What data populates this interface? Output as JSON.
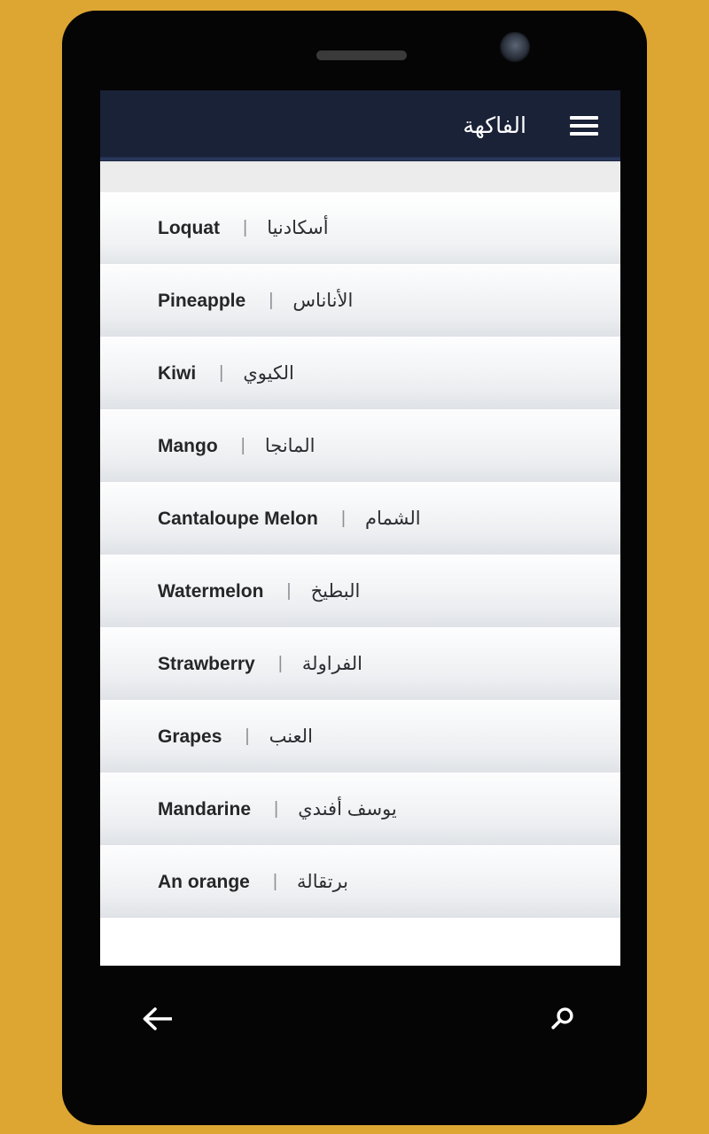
{
  "background": {
    "color": "#DDA633"
  },
  "device": {
    "name": "smartphone-mockup",
    "body_color": "#050505",
    "speaker": "speaker-grille",
    "camera": "front-camera"
  },
  "header": {
    "title": "الفاكهة",
    "background_color": "#1A2238",
    "text_color": "#FFFFFF",
    "menu_icon": "hamburger-menu-icon"
  },
  "list": {
    "items": [
      {
        "en": "Loquat",
        "sep": "|",
        "ar": "أسكادنيا"
      },
      {
        "en": "Pineapple",
        "sep": "|",
        "ar": "الأناناس"
      },
      {
        "en": "Kiwi",
        "sep": "|",
        "ar": "الكيوي"
      },
      {
        "en": "Mango",
        "sep": "|",
        "ar": "المانجا"
      },
      {
        "en": "Cantaloupe Melon",
        "sep": "|",
        "ar": "الشمام"
      },
      {
        "en": "Watermelon",
        "sep": "|",
        "ar": "البطيخ"
      },
      {
        "en": "Strawberry",
        "sep": "|",
        "ar": "الفراولة"
      },
      {
        "en": "Grapes",
        "sep": "|",
        "ar": "العنب"
      },
      {
        "en": "Mandarine",
        "sep": "|",
        "ar": "يوسف أفندي"
      },
      {
        "en": "An orange",
        "sep": "|",
        "ar": "برتقالة"
      }
    ]
  },
  "bottom_nav": {
    "back_icon": "arrow-left-icon",
    "search_icon": "search-icon",
    "icon_color": "#FFFFFF",
    "background_color": "#000000"
  }
}
